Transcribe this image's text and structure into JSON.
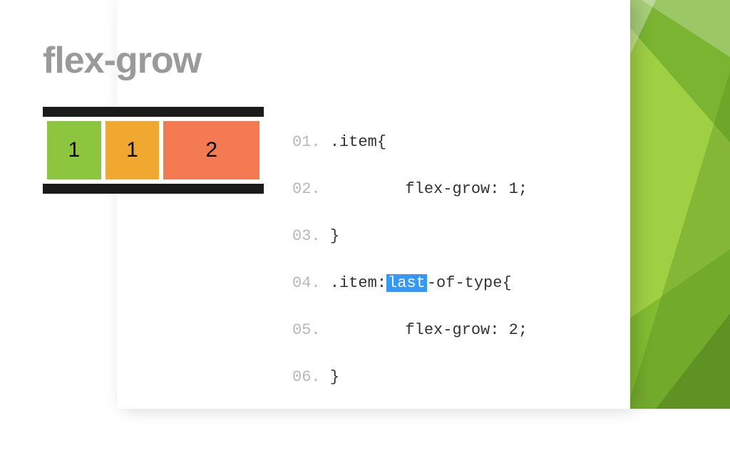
{
  "title": "flex-grow",
  "demo": {
    "items": [
      "1",
      "1",
      "2"
    ]
  },
  "code": {
    "lines": [
      {
        "num": "01.",
        "pre": ".item{"
      },
      {
        "num": "02.",
        "pre": "        flex-grow: 1;"
      },
      {
        "num": "03.",
        "pre": "}"
      },
      {
        "num": "04.",
        "pre": ".item:",
        "hl": "last",
        "post": "-of-type{"
      },
      {
        "num": "05.",
        "pre": "        flex-grow: 2;"
      },
      {
        "num": "06.",
        "pre": "}"
      }
    ]
  }
}
